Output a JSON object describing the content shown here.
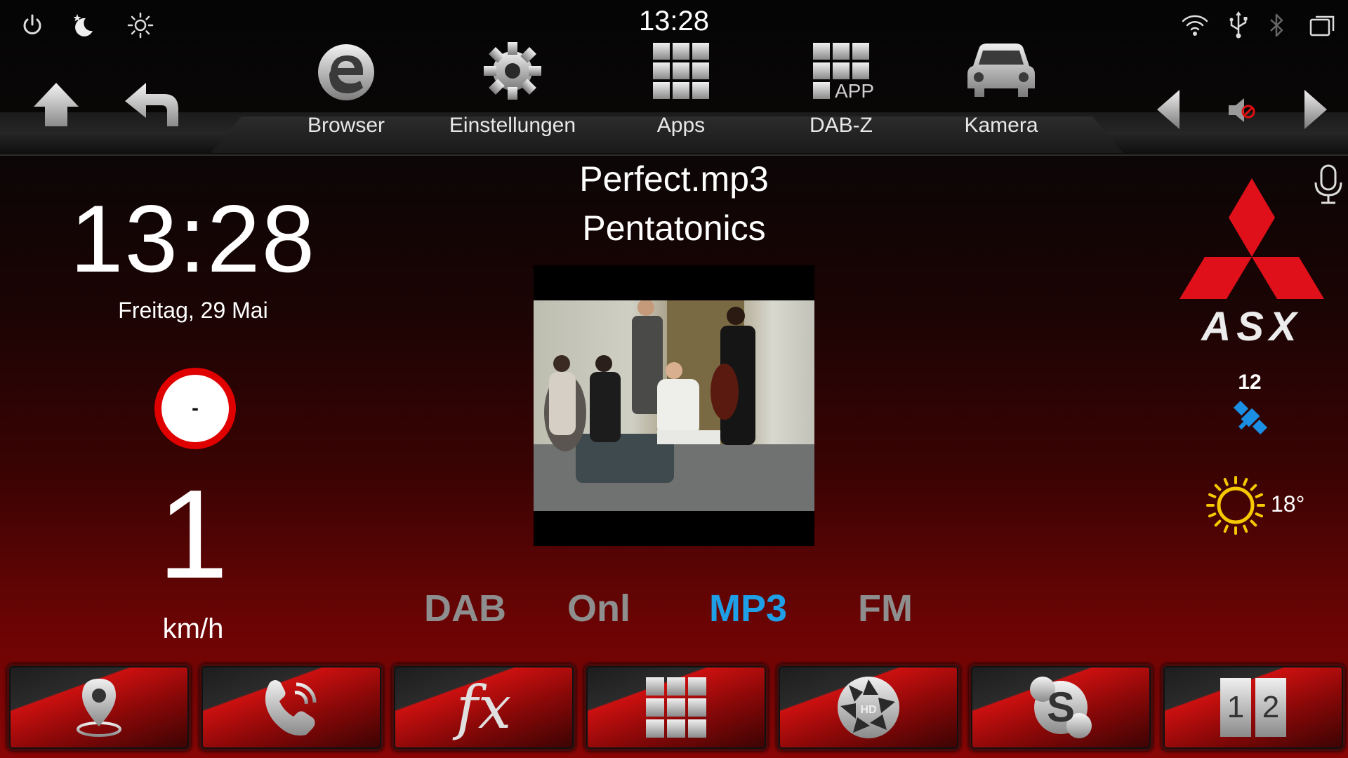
{
  "status_bar": {
    "time": "13:28",
    "icons": [
      "power-icon",
      "night-mode-icon",
      "brightness-icon",
      "wifi-icon",
      "usb-icon",
      "bluetooth-icon",
      "window-switch-icon"
    ]
  },
  "nav": {
    "items": [
      {
        "label": "Browser",
        "icon": "browser-icon"
      },
      {
        "label": "Einstellungen",
        "icon": "settings-gear-icon"
      },
      {
        "label": "Apps",
        "icon": "apps-grid-icon"
      },
      {
        "label": "DAB-Z",
        "icon": "dab-app-icon",
        "icon_text": "APP"
      },
      {
        "label": "Kamera",
        "icon": "car-camera-icon"
      }
    ]
  },
  "left": {
    "clock": "13:28",
    "date": "Freitag, 29 Mai",
    "speed_limit": "-",
    "speed": "1",
    "speed_unit": "km/h"
  },
  "media": {
    "title": "Perfect.mp3",
    "artist": "Pentatonics",
    "sources": [
      "DAB",
      "Onl",
      "MP3",
      "FM"
    ],
    "active_source": "MP3"
  },
  "right": {
    "brand_text": "ASX",
    "satellites": "12",
    "temperature": "18°"
  },
  "dock": {
    "items": [
      "navigation-pin-icon",
      "phone-icon",
      "fx-equalizer-icon",
      "grid-menu-icon",
      "hd-camera-icon",
      "skype-icon",
      "split-screen-icon"
    ],
    "fx_text": "fx",
    "split_text": [
      "1",
      "2"
    ]
  },
  "colors": {
    "accent_active": "#1e9fe6",
    "dock_red": "#cc1010",
    "logo_red": "#e0101a",
    "sun_yellow": "#f5c800"
  }
}
